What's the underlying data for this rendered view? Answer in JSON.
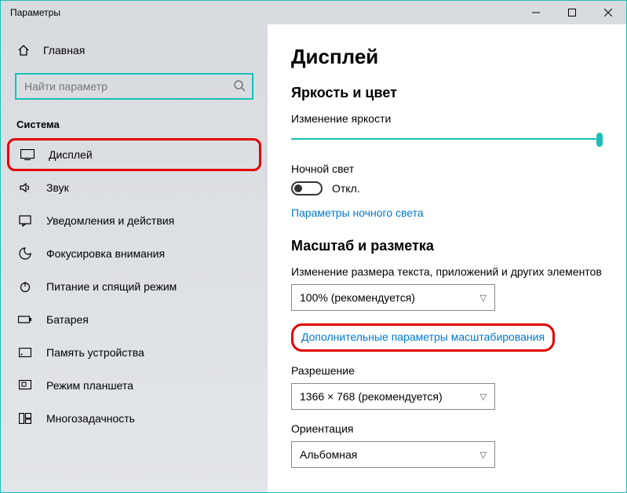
{
  "titlebar": {
    "title": "Параметры"
  },
  "sidebar": {
    "home": "Главная",
    "search_placeholder": "Найти параметр",
    "group": "Система",
    "items": [
      {
        "label": "Дисплей"
      },
      {
        "label": "Звук"
      },
      {
        "label": "Уведомления и действия"
      },
      {
        "label": "Фокусировка внимания"
      },
      {
        "label": "Питание и спящий режим"
      },
      {
        "label": "Батарея"
      },
      {
        "label": "Память устройства"
      },
      {
        "label": "Режим планшета"
      },
      {
        "label": "Многозадачность"
      }
    ]
  },
  "content": {
    "page_title": "Дисплей",
    "section_brightness": "Яркость и цвет",
    "brightness_label": "Изменение яркости",
    "night_light_heading": "Ночной свет",
    "night_light_state": "Откл.",
    "night_light_link": "Параметры ночного света",
    "section_scale": "Масштаб и разметка",
    "scale_label": "Изменение размера текста, приложений и других элементов",
    "scale_value": "100% (рекомендуется)",
    "scale_link": "Дополнительные параметры масштабирования",
    "resolution_label": "Разрешение",
    "resolution_value": "1366 × 768 (рекомендуется)",
    "orientation_label": "Ориентация",
    "orientation_value": "Альбомная"
  }
}
